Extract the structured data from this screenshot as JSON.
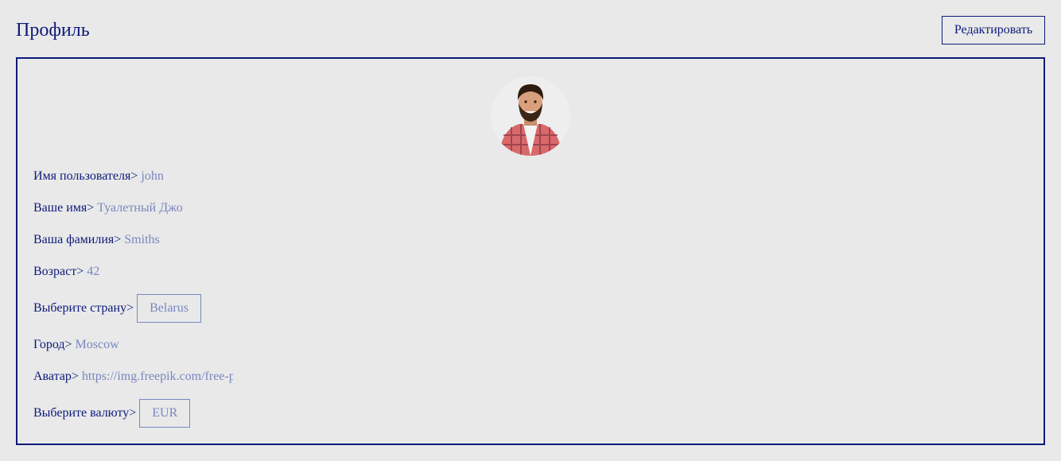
{
  "header": {
    "title": "Профиль",
    "edit_label": "Редактировать"
  },
  "profile": {
    "username": {
      "label": "Имя пользователя>",
      "value": "john"
    },
    "first_name": {
      "label": "Ваше имя>",
      "value": "Туалетный Джо"
    },
    "last_name": {
      "label": "Ваша фамилия>",
      "value": "Smiths"
    },
    "age": {
      "label": "Возраст>",
      "value": "42"
    },
    "country": {
      "label": "Выберите страну>",
      "value": "Belarus"
    },
    "city": {
      "label": "Город>",
      "value": "Moscow"
    },
    "avatar": {
      "label": "Аватар>",
      "value": "https://img.freepik.com/free-p"
    },
    "currency": {
      "label": "Выберите валюту>",
      "value": "EUR"
    }
  },
  "colors": {
    "primary": "#0c1a7a",
    "muted": "#7a86c0",
    "background": "#e9e9e9"
  }
}
